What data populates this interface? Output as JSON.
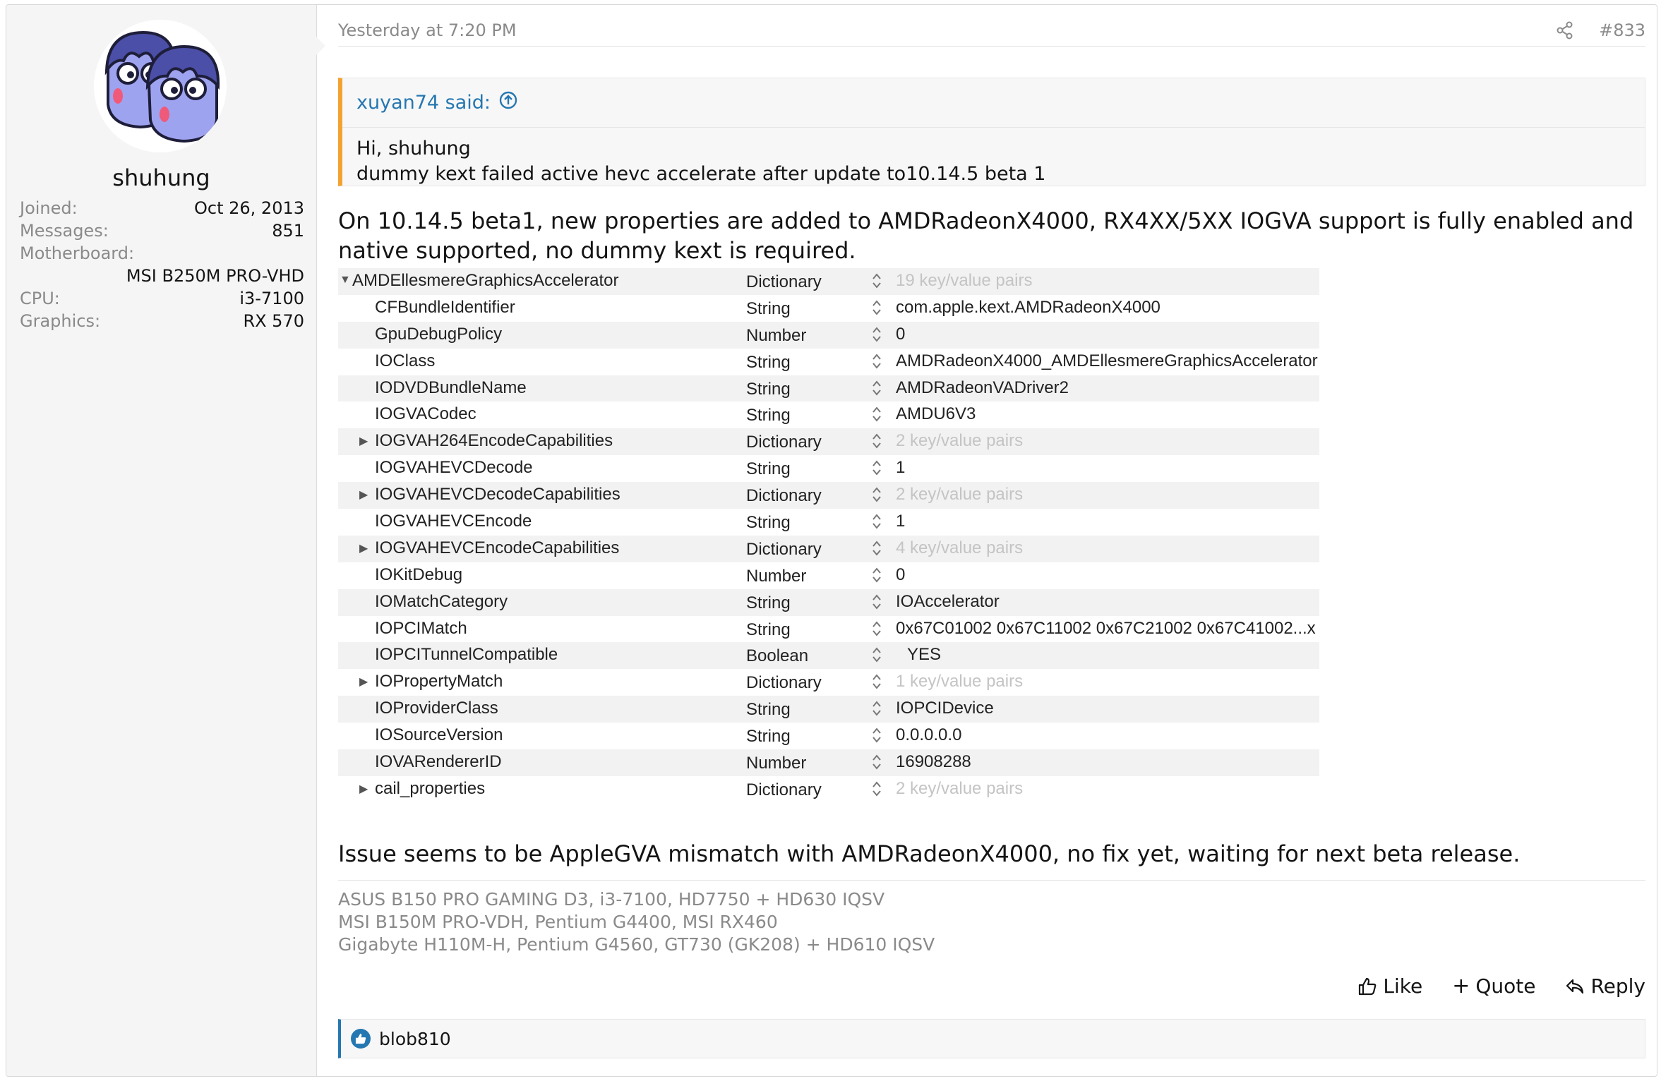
{
  "user": {
    "name": "shuhung",
    "fields": [
      {
        "label": "Joined:",
        "value": "Oct 26, 2013"
      },
      {
        "label": "Messages:",
        "value": "851"
      },
      {
        "label": "Motherboard:",
        "value": "MSI B250M PRO-VHD"
      },
      {
        "label": "CPU:",
        "value": "i3-7100"
      },
      {
        "label": "Graphics:",
        "value": "RX 570"
      }
    ]
  },
  "post": {
    "date": "Yesterday at 7:20 PM",
    "number": "#833",
    "quote": {
      "author": "xuyan74 said:",
      "lines": [
        "Hi,  shuhung",
        "dummy kext failed active hevc accelerate after update to10.14.5 beta 1"
      ]
    },
    "body": "On 10.14.5 beta1, new properties are added to AMDRadeonX4000, RX4XX/5XX IOGVA support is fully enabled and native supported, no dummy kext is required.",
    "properties": [
      {
        "key": "AMDEllesmereGraphicsAccelerator",
        "type": "Dictionary",
        "value": "19 key/value pairs",
        "expander": "open"
      },
      {
        "key": "CFBundleIdentifier",
        "type": "String",
        "value": "com.apple.kext.AMDRadeonX4000"
      },
      {
        "key": "GpuDebugPolicy",
        "type": "Number",
        "value": "0"
      },
      {
        "key": "IOClass",
        "type": "String",
        "value": "AMDRadeonX4000_AMDEllesmereGraphicsAccelerator"
      },
      {
        "key": "IODVDBundleName",
        "type": "String",
        "value": "AMDRadeonVADriver2"
      },
      {
        "key": "IOGVACodec",
        "type": "String",
        "value": "AMDU6V3"
      },
      {
        "key": "IOGVAH264EncodeCapabilities",
        "type": "Dictionary",
        "value": "2 key/value pairs",
        "expander": "closed"
      },
      {
        "key": "IOGVAHEVCDecode",
        "type": "String",
        "value": "1"
      },
      {
        "key": "IOGVAHEVCDecodeCapabilities",
        "type": "Dictionary",
        "value": "2 key/value pairs",
        "expander": "closed"
      },
      {
        "key": "IOGVAHEVCEncode",
        "type": "String",
        "value": "1"
      },
      {
        "key": "IOGVAHEVCEncodeCapabilities",
        "type": "Dictionary",
        "value": "4 key/value pairs",
        "expander": "closed"
      },
      {
        "key": "IOKitDebug",
        "type": "Number",
        "value": "0"
      },
      {
        "key": "IOMatchCategory",
        "type": "String",
        "value": "IOAccelerator"
      },
      {
        "key": "IOPCIMatch",
        "type": "String",
        "value": "0x67C01002 0x67C11002 0x67C21002 0x67C41002...x"
      },
      {
        "key": "IOPCITunnelCompatible",
        "type": "Boolean",
        "value": "YES"
      },
      {
        "key": "IOPropertyMatch",
        "type": "Dictionary",
        "value": "1 key/value pairs",
        "expander": "closed"
      },
      {
        "key": "IOProviderClass",
        "type": "String",
        "value": "IOPCIDevice"
      },
      {
        "key": "IOSourceVersion",
        "type": "String",
        "value": "0.0.0.0.0"
      },
      {
        "key": "IOVARendererID",
        "type": "Number",
        "value": "16908288"
      },
      {
        "key": "cail_properties",
        "type": "Dictionary",
        "value": "2 key/value pairs",
        "expander": "closed"
      }
    ],
    "issue": "Issue seems to be AppleGVA mismatch with AMDRadeonX4000, no fix yet, waiting for next beta release.",
    "signature": [
      "ASUS B150 PRO GAMING D3, i3-7100, HD7750 + HD630 IQSV",
      "MSI B150M PRO-VDH, Pentium G4400, MSI RX460",
      "Gigabyte H110M-H, Pentium G4560, GT730 (GK208) + HD610 IQSV"
    ],
    "actions": {
      "like": "Like",
      "quote": "Quote",
      "reply": "Reply"
    },
    "reactions": {
      "users": "blob810"
    }
  },
  "colors": {
    "link": "#2577b1",
    "quote_accent": "#f3a232",
    "muted": "#8a8a8a"
  }
}
